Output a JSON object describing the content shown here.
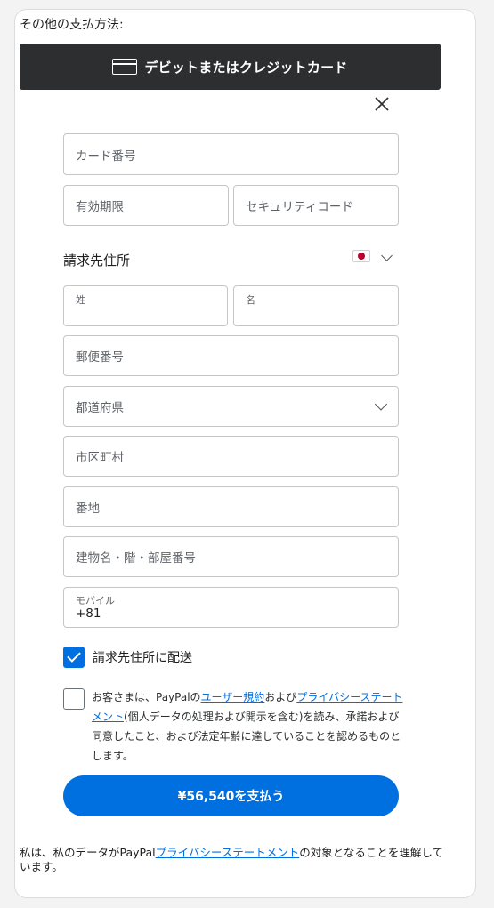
{
  "section": {
    "title": "その他の支払方法:"
  },
  "debit_button": {
    "label": "デビットまたはクレジットカード",
    "icon": "credit-card-icon"
  },
  "close_icon": "close-icon",
  "card_form": {
    "card_number_placeholder": "カード番号",
    "expiry_placeholder": "有効期限",
    "cvv_placeholder": "セキュリティコード"
  },
  "billing": {
    "title": "請求先住所",
    "country_flag": "japan-flag-icon",
    "last_name_label": "姓",
    "first_name_label": "名",
    "postal_placeholder": "郵便番号",
    "prefecture_placeholder": "都道府県",
    "city_placeholder": "市区町村",
    "address_placeholder": "番地",
    "building_placeholder": "建物名・階・部屋番号",
    "mobile_label": "モバイル",
    "mobile_value": "+81"
  },
  "ship_to_billing": {
    "label": "請求先住所に配送",
    "checked": true
  },
  "terms": {
    "checked": false,
    "text_1": "お客さまは、PayPalの",
    "link_user_agreement": "ユーザー規約",
    "text_2": "および",
    "link_privacy": "プライバシーステートメント",
    "text_3": "(個人データの処理および開示を含む)を読み、承諾および同意したこと、および法定年齢に達していることを認めるものとします。"
  },
  "pay_button": {
    "label": "¥56,540を支払う"
  },
  "footer": {
    "text_1": "私は、私のデータがPayPal",
    "link_privacy": "プライバシーステートメント",
    "text_2": "の対象となることを理解しています。"
  },
  "colors": {
    "accent": "#0070e0",
    "dark_button": "#2c2e2f",
    "background": "#f3f3f4"
  }
}
